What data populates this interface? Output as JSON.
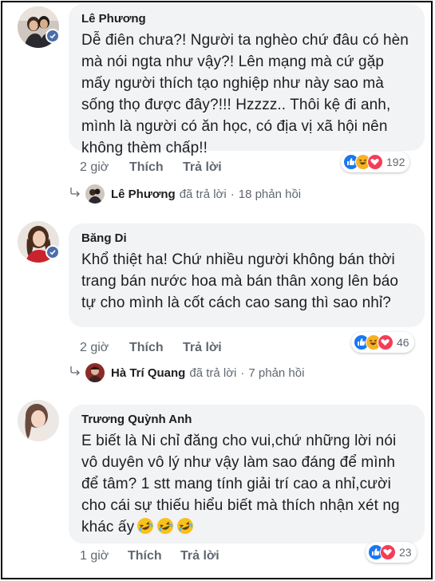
{
  "comments": [
    {
      "author": "Lê Phương",
      "text": "Dễ điên chưa?! Người ta nghèo chứ đâu có hèn mà nói ngta như vậy?! Lên mạng mà cứ gặp mấy người thích tạo nghiệp như này sao mà sống thọ được đây?!!! Hzzzz.. Thôi kệ đi anh, mình là người có ăn học, có địa vị xã hội nên không thèm chấp!!",
      "time": "2 giờ",
      "like_label": "Thích",
      "reply_label": "Trả lời",
      "reaction_icons": [
        "like",
        "haha",
        "love"
      ],
      "reaction_count": "192",
      "replied_by": "Lê Phương",
      "replied_text": "đã trả lời",
      "replies_count": "18 phản hồi"
    },
    {
      "author": "Băng Di",
      "text": "Khổ thiệt ha! Chứ nhiều người không bán thời trang bán nước hoa mà bán thân xong lên báo tự cho mình là cốt cách cao sang thì sao nhỉ?",
      "time": "2 giờ",
      "like_label": "Thích",
      "reply_label": "Trả lời",
      "reaction_icons": [
        "like",
        "haha",
        "love"
      ],
      "reaction_count": "46",
      "replied_by": "Hà Trí Quang",
      "replied_text": "đã trả lời",
      "replies_count": "7 phản hồi"
    },
    {
      "author": "Trương Quỳnh Anh",
      "text": "E biết là Ni chỉ đăng cho vui,chứ những lời nói vô duyên vô lý như vậy làm sao đáng để mình để tâm? 1 stt mang tính giải trí cao a nhỉ,cười cho cái sự thiếu hiểu biết mà thích nhận xét ng khác ấy",
      "emoji": "rolling-on-floor-laughing",
      "time": "1 giờ",
      "like_label": "Thích",
      "reply_label": "Trả lời",
      "reaction_icons": [
        "like",
        "love"
      ],
      "reaction_count": "23"
    }
  ],
  "colors": {
    "like": "#1877f2",
    "love": "#f33e58",
    "haha": "#f7b125",
    "bubble": "#f2f3f5",
    "verified": "#4a6ea9"
  }
}
